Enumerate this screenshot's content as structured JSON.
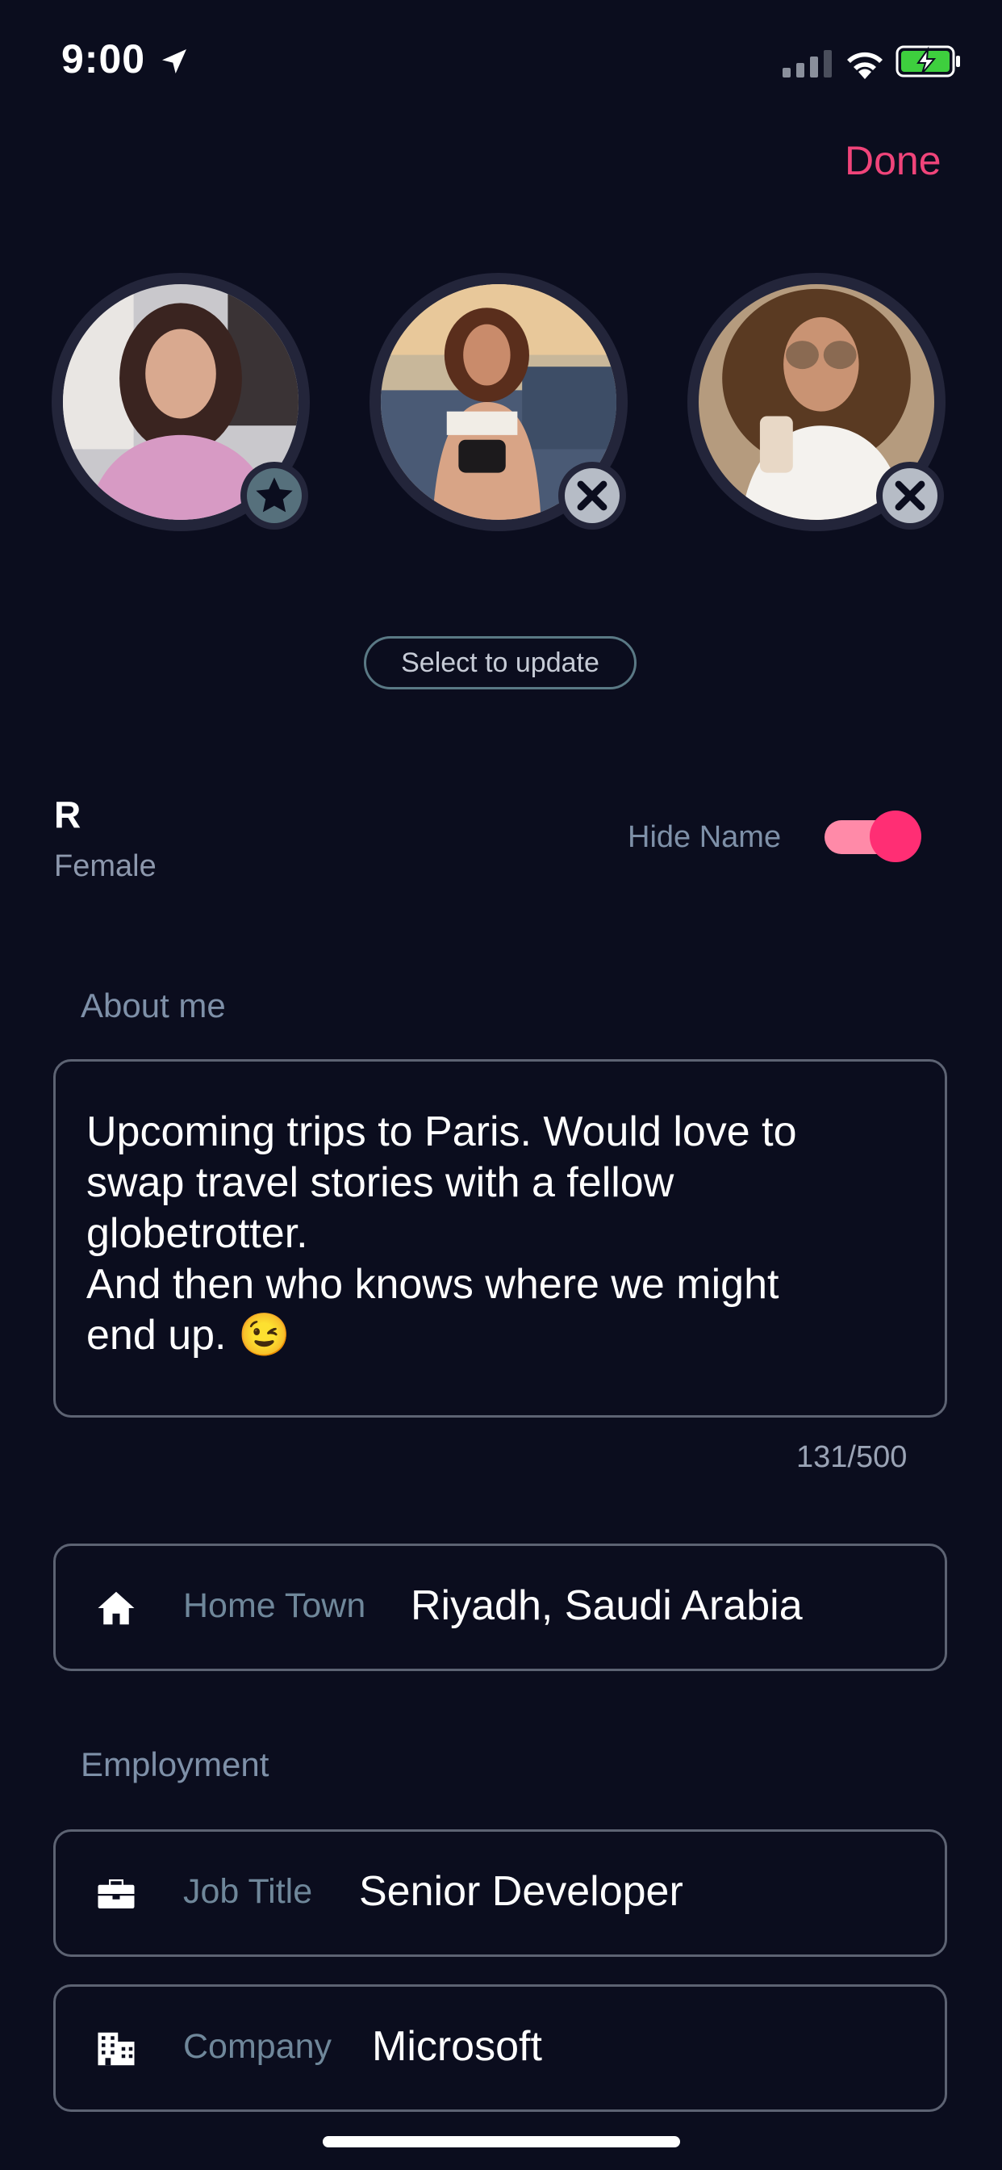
{
  "status_bar": {
    "time": "9:00",
    "location_icon": "location-arrow-icon",
    "signal_icon": "cellular-signal-icon",
    "wifi_icon": "wifi-icon",
    "battery_icon": "battery-charging-icon",
    "battery_color": "#3ecf3e"
  },
  "header": {
    "done_label": "Done",
    "accent_color": "#f0447a"
  },
  "photos": [
    {
      "name": "photo-1",
      "badge_icon": "star-icon"
    },
    {
      "name": "photo-2",
      "badge_icon": "close-icon"
    },
    {
      "name": "photo-3",
      "badge_icon": "close-icon"
    }
  ],
  "select_to_update_label": "Select to update",
  "profile": {
    "name": "R",
    "gender": "Female",
    "hide_name_label": "Hide Name",
    "hide_name_on": true
  },
  "about": {
    "section_label": "About me",
    "text": "Upcoming trips to Paris. Would love to\nswap travel stories with a fellow\nglobetrotter.\nAnd then who knows where we might\nend up. 😉",
    "counter": "131/500"
  },
  "home_town": {
    "icon": "home-icon",
    "label": "Home Town",
    "value": "Riyadh, Saudi Arabia"
  },
  "employment": {
    "section_label": "Employment",
    "job_title": {
      "icon": "briefcase-icon",
      "label": "Job Title",
      "value": "Senior Developer"
    },
    "company": {
      "icon": "building-icon",
      "label": "Company",
      "value": "Microsoft"
    }
  }
}
